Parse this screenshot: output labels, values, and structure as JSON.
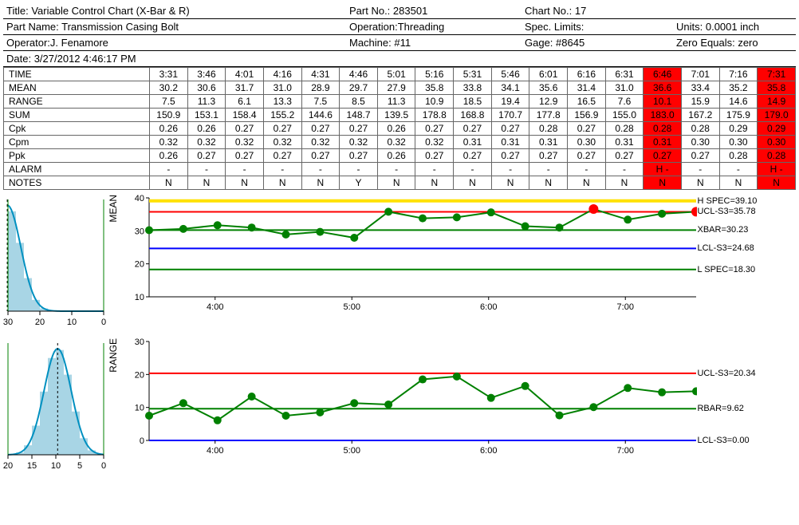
{
  "header": {
    "title_l": "Title:",
    "title_v": "Variable Control Chart (X-Bar & R)",
    "partno_l": "Part No.:",
    "partno_v": "283501",
    "chartno_l": "Chart No.:",
    "chartno_v": "17",
    "partname_l": "Part Name:",
    "partname_v": "Transmission Casing Bolt",
    "operation_l": "Operation:",
    "operation_v": "Threading",
    "speclim_l": "Spec. Limits:",
    "speclim_v": "",
    "units_l": "Units:",
    "units_v": "0.0001 inch",
    "operator_l": "Operator:",
    "operator_v": "J. Fenamore",
    "machine_l": "Machine:",
    "machine_v": "#11",
    "gage_l": "Gage:",
    "gage_v": "#8645",
    "zeroeq_l": "Zero Equals:",
    "zeroeq_v": "zero",
    "date_l": "Date:",
    "date_v": "3/27/2012 4:46:17 PM"
  },
  "rows": {
    "labels": [
      "TIME",
      "MEAN",
      "RANGE",
      "SUM",
      "Cpk",
      "Cpm",
      "Ppk",
      "ALARM",
      "NOTES"
    ],
    "time": [
      "3:31",
      "3:46",
      "4:01",
      "4:16",
      "4:31",
      "4:46",
      "5:01",
      "5:16",
      "5:31",
      "5:46",
      "6:01",
      "6:16",
      "6:31",
      "6:46",
      "7:01",
      "7:16",
      "7:31"
    ],
    "mean": [
      "30.2",
      "30.6",
      "31.7",
      "31.0",
      "28.9",
      "29.7",
      "27.9",
      "35.8",
      "33.8",
      "34.1",
      "35.6",
      "31.4",
      "31.0",
      "36.6",
      "33.4",
      "35.2",
      "35.8"
    ],
    "range": [
      "7.5",
      "11.3",
      "6.1",
      "13.3",
      "7.5",
      "8.5",
      "11.3",
      "10.9",
      "18.5",
      "19.4",
      "12.9",
      "16.5",
      "7.6",
      "10.1",
      "15.9",
      "14.6",
      "14.9"
    ],
    "sum": [
      "150.9",
      "153.1",
      "158.4",
      "155.2",
      "144.6",
      "148.7",
      "139.5",
      "178.8",
      "168.8",
      "170.7",
      "177.8",
      "156.9",
      "155.0",
      "183.0",
      "167.2",
      "175.9",
      "179.0"
    ],
    "cpk": [
      "0.26",
      "0.26",
      "0.27",
      "0.27",
      "0.27",
      "0.27",
      "0.26",
      "0.27",
      "0.27",
      "0.27",
      "0.28",
      "0.27",
      "0.28",
      "0.28",
      "0.28",
      "0.29",
      "0.29"
    ],
    "cpm": [
      "0.32",
      "0.32",
      "0.32",
      "0.32",
      "0.32",
      "0.32",
      "0.32",
      "0.32",
      "0.31",
      "0.31",
      "0.31",
      "0.30",
      "0.31",
      "0.31",
      "0.30",
      "0.30",
      "0.30"
    ],
    "ppk": [
      "0.26",
      "0.27",
      "0.27",
      "0.27",
      "0.27",
      "0.27",
      "0.26",
      "0.27",
      "0.27",
      "0.27",
      "0.27",
      "0.27",
      "0.27",
      "0.27",
      "0.27",
      "0.28",
      "0.28"
    ],
    "alarm": [
      "-",
      "-",
      "-",
      "-",
      "-",
      "-",
      "-",
      "-",
      "-",
      "-",
      "-",
      "-",
      "-",
      "H",
      "-",
      "-",
      "H"
    ],
    "alarm2": [
      "",
      "",
      "",
      "",
      "",
      "",
      "",
      "",
      "",
      "",
      "",
      "",
      "",
      "-",
      "",
      "",
      "-"
    ],
    "notes": [
      "N",
      "N",
      "N",
      "N",
      "N",
      "Y",
      "N",
      "N",
      "N",
      "N",
      "N",
      "N",
      "N",
      "N",
      "N",
      "N",
      "N"
    ],
    "alarm_cols": [
      13,
      16
    ]
  },
  "chart_data": [
    {
      "type": "line",
      "name": "MEAN",
      "x_times": [
        "3:31",
        "3:46",
        "4:01",
        "4:16",
        "4:31",
        "4:46",
        "5:01",
        "5:16",
        "5:31",
        "5:46",
        "6:01",
        "6:16",
        "6:31",
        "6:46",
        "7:01",
        "7:16",
        "7:31"
      ],
      "y": [
        30.2,
        30.6,
        31.7,
        31.0,
        28.9,
        29.7,
        27.9,
        35.8,
        33.8,
        34.1,
        35.6,
        31.4,
        31.0,
        36.6,
        33.4,
        35.2,
        35.8
      ],
      "alarm_idx": [
        13,
        16
      ],
      "ylim": [
        10,
        40
      ],
      "yticks": [
        10,
        20,
        30,
        40
      ],
      "x_major": [
        "4:00",
        "5:00",
        "6:00",
        "7:00"
      ],
      "limits": [
        {
          "label": "H SPEC=39.10",
          "value": 39.1,
          "color": "yellow"
        },
        {
          "label": "UCL-S3=35.78",
          "value": 35.78,
          "color": "red"
        },
        {
          "label": "XBAR=30.23",
          "value": 30.23,
          "color": "green"
        },
        {
          "label": "LCL-S3=24.68",
          "value": 24.68,
          "color": "blue"
        },
        {
          "label": "L SPEC=18.30",
          "value": 18.3,
          "color": "green"
        }
      ]
    },
    {
      "type": "line",
      "name": "RANGE",
      "x_times": [
        "3:31",
        "3:46",
        "4:01",
        "4:16",
        "4:31",
        "4:46",
        "5:01",
        "5:16",
        "5:31",
        "5:46",
        "6:01",
        "6:16",
        "6:31",
        "6:46",
        "7:01",
        "7:16",
        "7:31"
      ],
      "y": [
        7.5,
        11.3,
        6.1,
        13.3,
        7.5,
        8.5,
        11.3,
        10.9,
        18.5,
        19.4,
        12.9,
        16.5,
        7.6,
        10.1,
        15.9,
        14.6,
        14.9
      ],
      "alarm_idx": [],
      "ylim": [
        0,
        30
      ],
      "yticks": [
        0,
        10,
        20,
        30
      ],
      "x_major": [
        "4:00",
        "5:00",
        "6:00",
        "7:00"
      ],
      "limits": [
        {
          "label": "UCL-S3=20.34",
          "value": 20.34,
          "color": "red"
        },
        {
          "label": "RBAR=9.62",
          "value": 9.62,
          "color": "green"
        },
        {
          "label": "LCL-S3=0.00",
          "value": 0.0,
          "color": "blue"
        }
      ]
    }
  ],
  "histograms": [
    {
      "range": [
        0,
        30
      ],
      "ticks": [
        0,
        10,
        20,
        30
      ],
      "mode": 30.23
    },
    {
      "range": [
        0,
        20
      ],
      "ticks": [
        0,
        5,
        10,
        15,
        20
      ],
      "mode": 9.62
    }
  ]
}
